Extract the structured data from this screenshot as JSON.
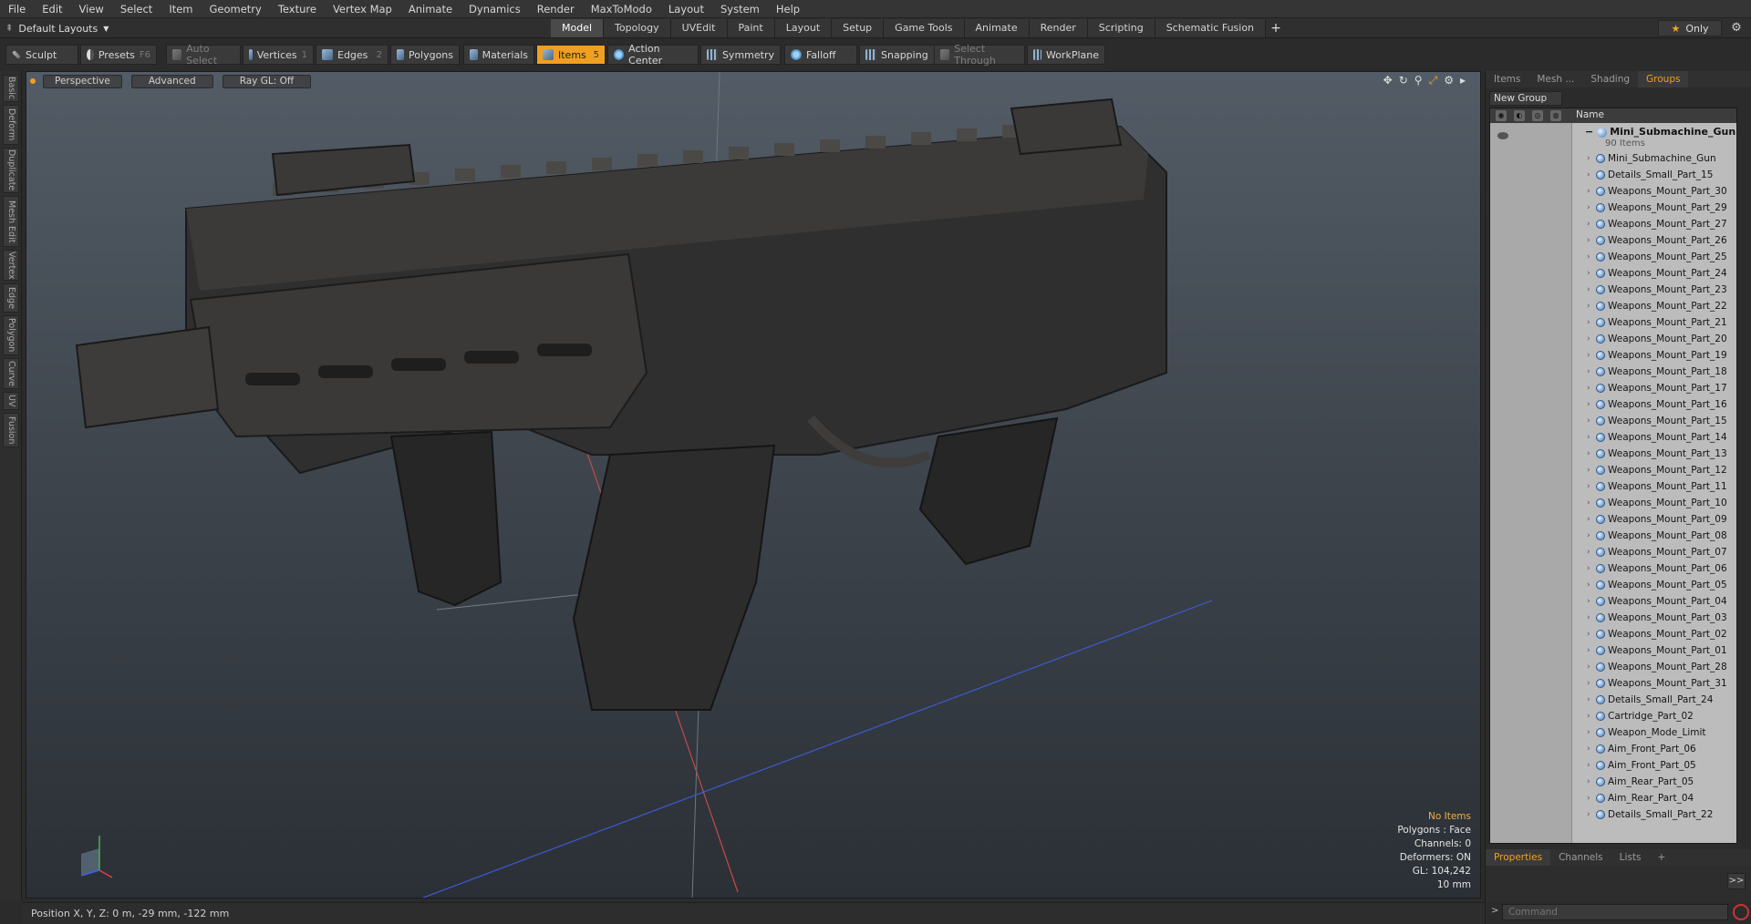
{
  "menu": [
    "File",
    "Edit",
    "View",
    "Select",
    "Item",
    "Geometry",
    "Texture",
    "Vertex Map",
    "Animate",
    "Dynamics",
    "Render",
    "MaxToModo",
    "Layout",
    "System",
    "Help"
  ],
  "layout_select": "Default Layouts",
  "mode_tabs": [
    "Model",
    "Topology",
    "UVEdit",
    "Paint",
    "Layout",
    "Setup",
    "Game Tools",
    "Animate",
    "Render",
    "Scripting",
    "Schematic Fusion"
  ],
  "only_label": "Only",
  "toolbar": {
    "sculpt": "Sculpt",
    "presets": "Presets",
    "presets_key": "F6",
    "auto_select": "Auto Select",
    "vertices": "Vertices",
    "vertices_key": "1",
    "edges": "Edges",
    "edges_key": "2",
    "polygons": "Polygons",
    "materials": "Materials",
    "items": "Items",
    "items_key": "5",
    "action_center": "Action Center",
    "symmetry": "Symmetry",
    "falloff": "Falloff",
    "snapping": "Snapping",
    "select_through": "Select Through",
    "workplane": "WorkPlane"
  },
  "left_tabs": [
    "Basic",
    "Deform",
    "Duplicate",
    "Mesh Edit",
    "Vertex",
    "Edge",
    "Polygon",
    "Curve",
    "UV",
    "Fusion"
  ],
  "viewport": {
    "view": "Perspective",
    "shading": "Advanced",
    "raygl": "Ray GL: Off",
    "info": {
      "selection": "No Items",
      "polygons": "Polygons : Face",
      "channels": "Channels: 0",
      "deformers": "Deformers: ON",
      "gl": "GL: 104,242",
      "scale": "10 mm"
    }
  },
  "status": "Position X, Y, Z:  0 m, -29 mm, -122 mm",
  "right_panel": {
    "tabs": [
      "Items",
      "Mesh ...",
      "Shading",
      "Groups"
    ],
    "active_tab": "Groups",
    "new_group": "New Group",
    "name_header": "Name",
    "root_name": "Mini_Submachine_Gun",
    "root_count": "90 Items",
    "items": [
      "Mini_Submachine_Gun",
      "Details_Small_Part_15",
      "Weapons_Mount_Part_30",
      "Weapons_Mount_Part_29",
      "Weapons_Mount_Part_27",
      "Weapons_Mount_Part_26",
      "Weapons_Mount_Part_25",
      "Weapons_Mount_Part_24",
      "Weapons_Mount_Part_23",
      "Weapons_Mount_Part_22",
      "Weapons_Mount_Part_21",
      "Weapons_Mount_Part_20",
      "Weapons_Mount_Part_19",
      "Weapons_Mount_Part_18",
      "Weapons_Mount_Part_17",
      "Weapons_Mount_Part_16",
      "Weapons_Mount_Part_15",
      "Weapons_Mount_Part_14",
      "Weapons_Mount_Part_13",
      "Weapons_Mount_Part_12",
      "Weapons_Mount_Part_11",
      "Weapons_Mount_Part_10",
      "Weapons_Mount_Part_09",
      "Weapons_Mount_Part_08",
      "Weapons_Mount_Part_07",
      "Weapons_Mount_Part_06",
      "Weapons_Mount_Part_05",
      "Weapons_Mount_Part_04",
      "Weapons_Mount_Part_03",
      "Weapons_Mount_Part_02",
      "Weapons_Mount_Part_01",
      "Weapons_Mount_Part_28",
      "Weapons_Mount_Part_31",
      "Details_Small_Part_24",
      "Cartridge_Part_02",
      "Weapon_Mode_Limit",
      "Aim_Front_Part_06",
      "Aim_Front_Part_05",
      "Aim_Rear_Part_05",
      "Aim_Rear_Part_04",
      "Details_Small_Part_22"
    ],
    "bottom_tabs": [
      "Properties",
      "Channels",
      "Lists"
    ],
    "bottom_active": "Properties",
    "command_placeholder": "Command"
  },
  "colors": {
    "accent": "#f0a020",
    "list_bg": "#bcbcbc"
  }
}
